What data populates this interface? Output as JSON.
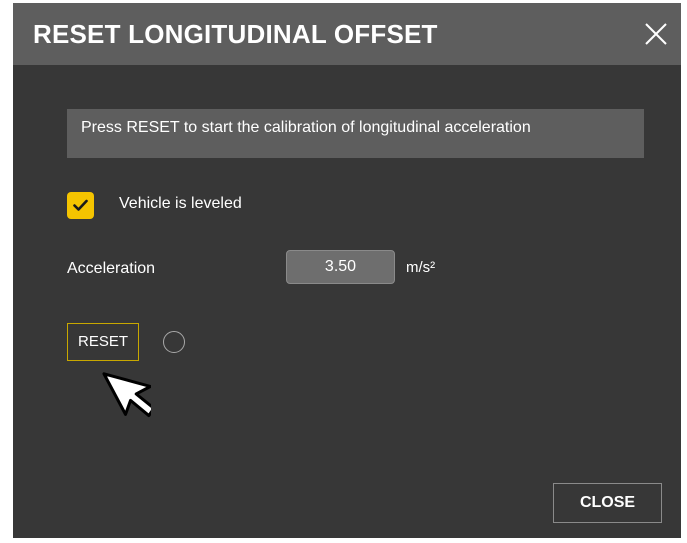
{
  "dialog": {
    "title": "RESET LONGITUDINAL OFFSET",
    "close_icon": "close-x-icon",
    "info_text": "Press RESET to start the calibration of longitudinal acceleration",
    "checkbox": {
      "label": "Vehicle is leveled",
      "checked": true,
      "icon": "checkmark-icon",
      "color": "#f5c400"
    },
    "acceleration": {
      "label": "Acceleration",
      "value": "3.50",
      "unit": "m/s²"
    },
    "reset_button": {
      "label": "RESET",
      "border_color": "#c8a800"
    },
    "status_indicator": "empty-circle-icon",
    "cursor_icon": "arrow-cursor-icon",
    "close_button": {
      "label": "CLOSE"
    }
  }
}
